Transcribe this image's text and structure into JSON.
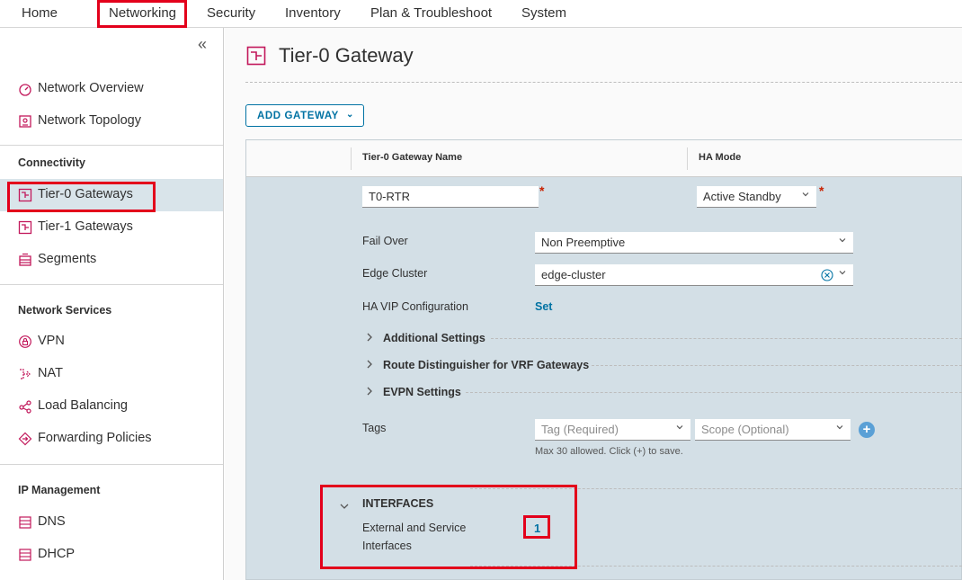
{
  "topnav": {
    "tabs": [
      "Home",
      "Networking",
      "Security",
      "Inventory",
      "Plan & Troubleshoot",
      "System"
    ]
  },
  "sidebar": {
    "collapse_icon": "double-chevron-left-icon",
    "top_items": [
      {
        "label": "Network Overview",
        "icon": "speedometer-icon"
      },
      {
        "label": "Network Topology",
        "icon": "topology-icon"
      }
    ],
    "sections": [
      {
        "heading": "Connectivity",
        "items": [
          {
            "label": "Tier-0 Gateways",
            "icon": "gateway-icon",
            "active": true
          },
          {
            "label": "Tier-1 Gateways",
            "icon": "gateway-icon"
          },
          {
            "label": "Segments",
            "icon": "segments-icon"
          }
        ]
      },
      {
        "heading": "Network Services",
        "items": [
          {
            "label": "VPN",
            "icon": "lock-icon"
          },
          {
            "label": "NAT",
            "icon": "nat-icon"
          },
          {
            "label": "Load Balancing",
            "icon": "load-balancer-icon"
          },
          {
            "label": "Forwarding Policies",
            "icon": "forwarding-icon"
          }
        ]
      },
      {
        "heading": "IP Management",
        "items": [
          {
            "label": "DNS",
            "icon": "server-icon"
          },
          {
            "label": "DHCP",
            "icon": "server-icon"
          }
        ]
      }
    ]
  },
  "main": {
    "title": "Tier-0 Gateway",
    "add_button": "ADD GATEWAY",
    "columns": [
      "Tier-0 Gateway Name",
      "HA Mode"
    ],
    "name_value": "T0-RTR",
    "ha_mode_value": "Active Standby",
    "fail_over": {
      "label": "Fail Over",
      "value": "Non Preemptive"
    },
    "edge_cluster": {
      "label": "Edge Cluster",
      "value": "edge-cluster"
    },
    "ha_vip": {
      "label": "HA VIP Configuration",
      "link": "Set"
    },
    "expanders": [
      "Additional Settings",
      "Route Distinguisher for VRF Gateways",
      "EVPN Settings"
    ],
    "tags": {
      "label": "Tags",
      "tag_placeholder": "Tag (Required)",
      "scope_placeholder": "Scope (Optional)",
      "hint": "Max 30 allowed. Click (+) to save.",
      "add_symbol": "+"
    },
    "interfaces": {
      "heading": "INTERFACES",
      "label_line1": "External and Service",
      "label_line2": "Interfaces",
      "count": "1"
    }
  },
  "colors": {
    "highlight": "#e3001b",
    "accent": "#0072a3",
    "panel": "#d3dfe6",
    "icon": "#c2185b"
  }
}
